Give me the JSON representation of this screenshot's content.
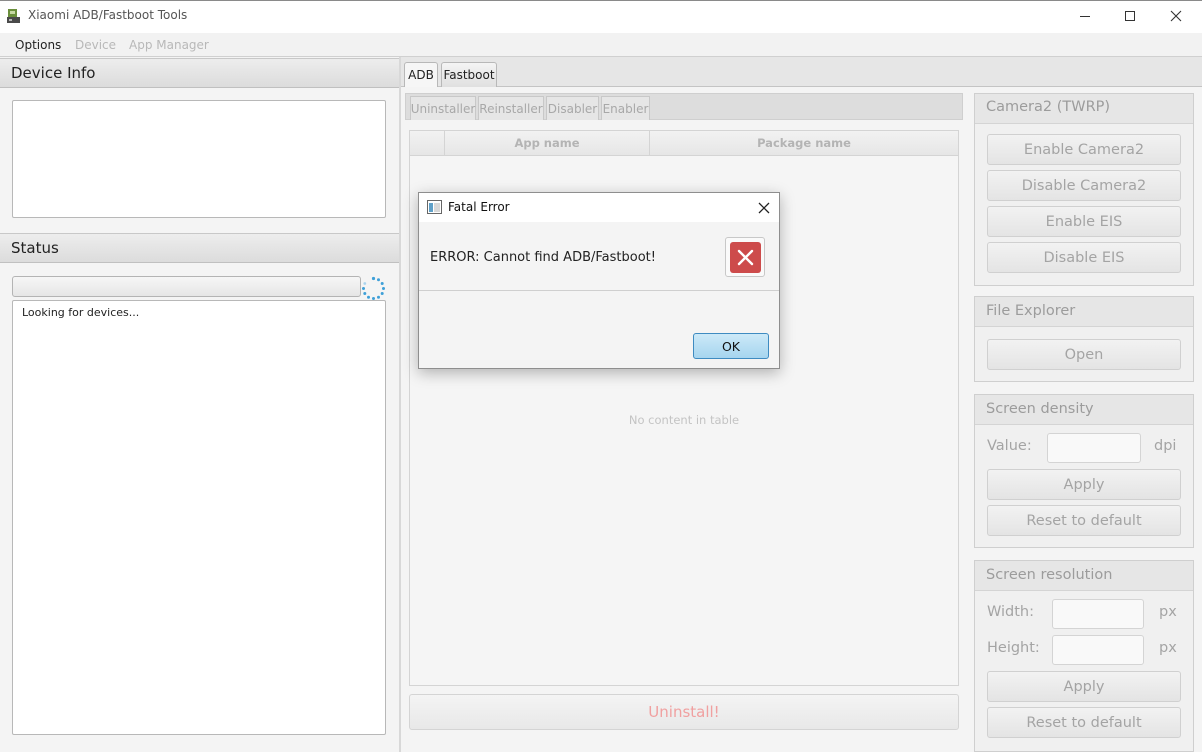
{
  "window": {
    "title": "Xiaomi ADB/Fastboot Tools",
    "controls": [
      "minimize-icon",
      "maximize-icon",
      "close-icon"
    ]
  },
  "menu": {
    "options": "Options",
    "device": "Device",
    "app_manager": "App Manager"
  },
  "device_info": {
    "header": "Device Info"
  },
  "status": {
    "header": "Status",
    "progress_indeterminate": true,
    "log": "Looking for devices..."
  },
  "tabs": [
    "ADB",
    "Fastboot"
  ],
  "subtabs": [
    "Uninstaller",
    "Reinstaller",
    "Disabler",
    "Enabler"
  ],
  "table": {
    "columns": [
      "App name",
      "Package name"
    ],
    "empty_text": "No content in table"
  },
  "uninstall_button": "Uninstall!",
  "camera2": {
    "title": "Camera2 (TWRP)",
    "enable_camera2": "Enable Camera2",
    "disable_camera2": "Disable Camera2",
    "enable_eis": "Enable EIS",
    "disable_eis": "Disable EIS"
  },
  "file_explorer": {
    "title": "File Explorer",
    "open": "Open"
  },
  "screen_density": {
    "title": "Screen density",
    "value_label": "Value:",
    "value": "",
    "unit": "dpi",
    "apply": "Apply",
    "reset": "Reset to default"
  },
  "screen_resolution": {
    "title": "Screen resolution",
    "width_label": "Width:",
    "width_value": "",
    "height_label": "Height:",
    "height_value": "",
    "unit": "px",
    "apply": "Apply",
    "reset": "Reset to default"
  },
  "dialog": {
    "title": "Fatal Error",
    "message": "ERROR: Cannot find ADB/Fastboot!",
    "icon": "error-icon",
    "ok": "OK"
  },
  "colors": {
    "error_red": "#cd4b4b",
    "ok_blue": "#a6d5ef",
    "uninstall_text": "#f0a0a0",
    "spinner": "#3fa0d8"
  }
}
